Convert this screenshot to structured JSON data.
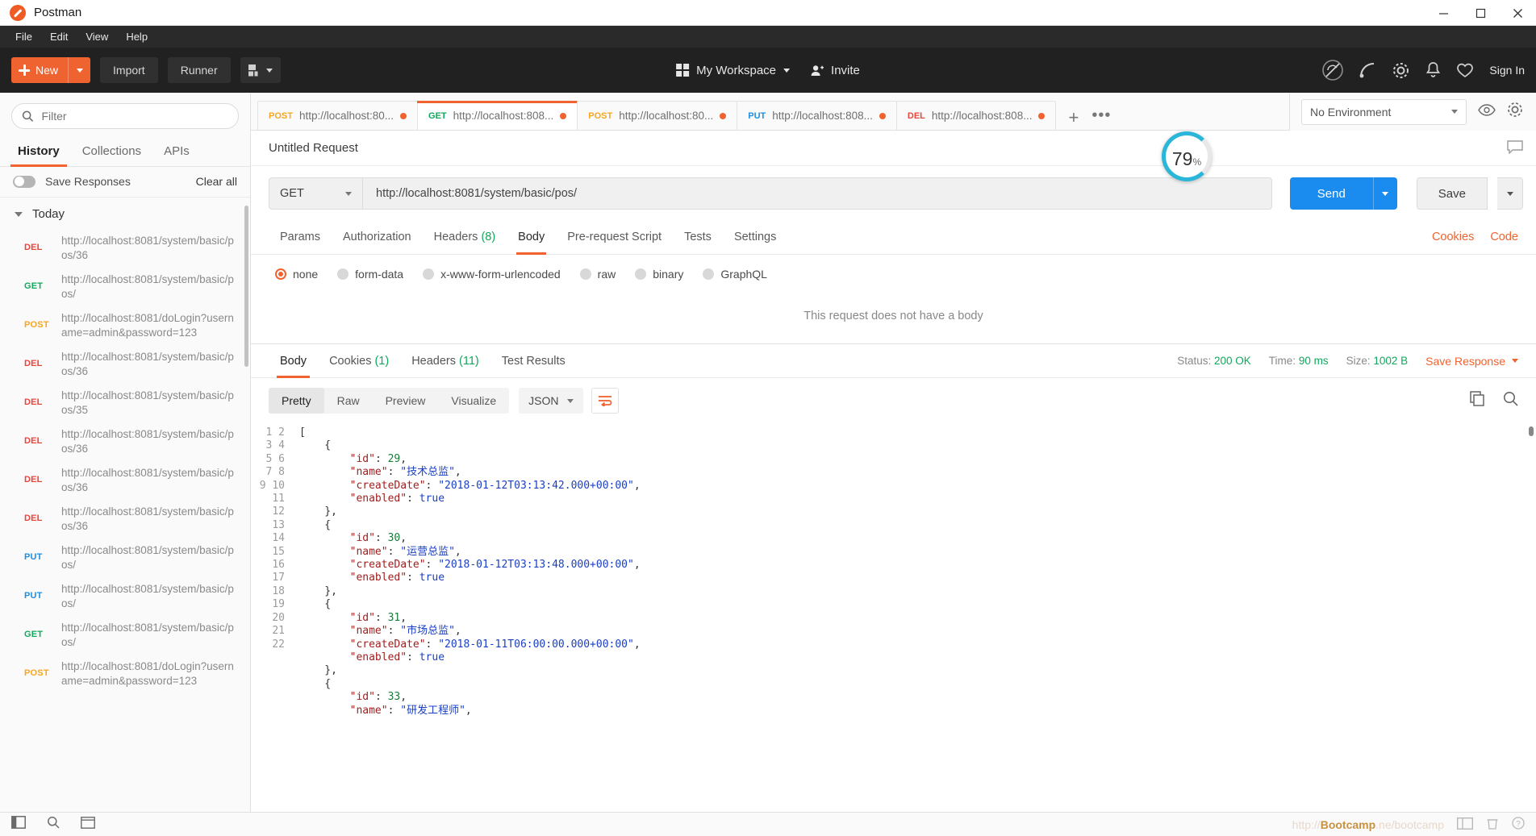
{
  "window": {
    "title": "Postman",
    "minimize": "minimize-icon",
    "maximize": "maximize-icon",
    "close": "close-icon"
  },
  "menubar": {
    "items": [
      "File",
      "Edit",
      "View",
      "Help"
    ]
  },
  "toolbar": {
    "new_label": "New",
    "import_label": "Import",
    "runner_label": "Runner",
    "workspace_label": "My Workspace",
    "invite_label": "Invite",
    "signin_label": "Sign In"
  },
  "sidebar": {
    "filter_placeholder": "Filter",
    "tabs": [
      "History",
      "Collections",
      "APIs"
    ],
    "active_tab": "History",
    "save_responses_label": "Save Responses",
    "clear_all_label": "Clear all",
    "group_label": "Today",
    "history": [
      {
        "method": "DEL",
        "url": "http://localhost:8081/system/basic/pos/36"
      },
      {
        "method": "GET",
        "url": "http://localhost:8081/system/basic/pos/"
      },
      {
        "method": "POST",
        "url": "http://localhost:8081/doLogin?username=admin&password=123"
      },
      {
        "method": "DEL",
        "url": "http://localhost:8081/system/basic/pos/36"
      },
      {
        "method": "DEL",
        "url": "http://localhost:8081/system/basic/pos/35"
      },
      {
        "method": "DEL",
        "url": "http://localhost:8081/system/basic/pos/36"
      },
      {
        "method": "DEL",
        "url": "http://localhost:8081/system/basic/pos/36"
      },
      {
        "method": "DEL",
        "url": "http://localhost:8081/system/basic/pos/36"
      },
      {
        "method": "PUT",
        "url": "http://localhost:8081/system/basic/pos/"
      },
      {
        "method": "PUT",
        "url": "http://localhost:8081/system/basic/pos/"
      },
      {
        "method": "GET",
        "url": "http://localhost:8081/system/basic/pos/"
      },
      {
        "method": "POST",
        "url": "http://localhost:8081/doLogin?username=admin&password=123"
      }
    ]
  },
  "tabstrip": {
    "tabs": [
      {
        "method": "POST",
        "url": "http://localhost:80...",
        "active": false,
        "unsaved": true
      },
      {
        "method": "GET",
        "url": "http://localhost:808...",
        "active": true,
        "unsaved": true
      },
      {
        "method": "POST",
        "url": "http://localhost:80...",
        "active": false,
        "unsaved": true
      },
      {
        "method": "PUT",
        "url": "http://localhost:808...",
        "active": false,
        "unsaved": true
      },
      {
        "method": "DEL",
        "url": "http://localhost:808...",
        "active": false,
        "unsaved": true
      }
    ],
    "add_label": "+",
    "more_label": "•••",
    "environment": "No Environment"
  },
  "request": {
    "title": "Untitled Request",
    "method": "GET",
    "url": "http://localhost:8081/system/basic/pos/",
    "send_label": "Send",
    "save_label": "Save",
    "tabs": [
      {
        "label": "Params",
        "count": ""
      },
      {
        "label": "Authorization",
        "count": ""
      },
      {
        "label": "Headers",
        "count": "(8)"
      },
      {
        "label": "Body",
        "count": ""
      },
      {
        "label": "Pre-request Script",
        "count": ""
      },
      {
        "label": "Tests",
        "count": ""
      },
      {
        "label": "Settings",
        "count": ""
      }
    ],
    "active_tab": "Body",
    "cookies_link": "Cookies",
    "code_link": "Code",
    "body_options": [
      "none",
      "form-data",
      "x-www-form-urlencoded",
      "raw",
      "binary",
      "GraphQL"
    ],
    "body_selected": "none",
    "no_body_text": "This request does not have a body"
  },
  "response": {
    "tabs": [
      {
        "label": "Body",
        "count": ""
      },
      {
        "label": "Cookies",
        "count": "(1)"
      },
      {
        "label": "Headers",
        "count": "(11)"
      },
      {
        "label": "Test Results",
        "count": ""
      }
    ],
    "active_tab": "Body",
    "status_label": "Status:",
    "status_value": "200 OK",
    "time_label": "Time:",
    "time_value": "90 ms",
    "size_label": "Size:",
    "size_value": "1002 B",
    "save_response_label": "Save Response",
    "format_buttons": [
      "Pretty",
      "Raw",
      "Preview",
      "Visualize"
    ],
    "format_active": "Pretty",
    "language": "JSON",
    "wrap_icon": "word-wrap-icon",
    "copy_icon": "copy-icon",
    "search_icon": "search-icon",
    "json_lines": [
      {
        "n": 1,
        "t": "["
      },
      {
        "n": 2,
        "t": "    {"
      },
      {
        "n": 3,
        "t": "        \"id\": 29,"
      },
      {
        "n": 4,
        "t": "        \"name\": \"技术总监\","
      },
      {
        "n": 5,
        "t": "        \"createDate\": \"2018-01-12T03:13:42.000+00:00\","
      },
      {
        "n": 6,
        "t": "        \"enabled\": true"
      },
      {
        "n": 7,
        "t": "    },"
      },
      {
        "n": 8,
        "t": "    {"
      },
      {
        "n": 9,
        "t": "        \"id\": 30,"
      },
      {
        "n": 10,
        "t": "        \"name\": \"运营总监\","
      },
      {
        "n": 11,
        "t": "        \"createDate\": \"2018-01-12T03:13:48.000+00:00\","
      },
      {
        "n": 12,
        "t": "        \"enabled\": true"
      },
      {
        "n": 13,
        "t": "    },"
      },
      {
        "n": 14,
        "t": "    {"
      },
      {
        "n": 15,
        "t": "        \"id\": 31,"
      },
      {
        "n": 16,
        "t": "        \"name\": \"市场总监\","
      },
      {
        "n": 17,
        "t": "        \"createDate\": \"2018-01-11T06:00:00.000+00:00\","
      },
      {
        "n": 18,
        "t": "        \"enabled\": true"
      },
      {
        "n": 19,
        "t": "    },"
      },
      {
        "n": 20,
        "t": "    {"
      },
      {
        "n": 21,
        "t": "        \"id\": 33,"
      },
      {
        "n": 22,
        "t": "        \"name\": \"研发工程师\","
      }
    ],
    "json_payload": [
      {
        "id": 29,
        "name": "技术总监",
        "createDate": "2018-01-12T03:13:42.000+00:00",
        "enabled": true
      },
      {
        "id": 30,
        "name": "运营总监",
        "createDate": "2018-01-12T03:13:48.000+00:00",
        "enabled": true
      },
      {
        "id": 31,
        "name": "市场总监",
        "createDate": "2018-01-11T06:00:00.000+00:00",
        "enabled": true
      },
      {
        "id": 33,
        "name": "研发工程师"
      }
    ]
  },
  "overlay": {
    "progress_value": "79",
    "progress_unit": "%"
  },
  "statusbar": {
    "watermark": "Bootcamp"
  },
  "colors": {
    "accent_orange": "#ef6330",
    "send_blue": "#1a8cf0",
    "method_get": "#11a75c",
    "method_post": "#f5a623",
    "method_put": "#1e8fe0",
    "method_del": "#e8453c",
    "dark_toolbar": "#212121"
  }
}
